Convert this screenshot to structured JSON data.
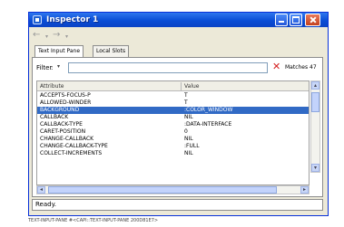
{
  "window": {
    "title": "Inspector 1"
  },
  "toolbar": {
    "back_icon": "left-arrow",
    "forward_icon": "right-arrow"
  },
  "tabs": [
    {
      "label": "Text Input Pane",
      "active": true
    },
    {
      "label": "Local Slots",
      "active": false
    }
  ],
  "filter": {
    "label": "Filter",
    "value": "",
    "matches": "Matches 47"
  },
  "table": {
    "columns": [
      "Attribute",
      "Value"
    ],
    "rows": [
      {
        "attribute": "ACCEPTS-FOCUS-P",
        "value": "T"
      },
      {
        "attribute": "ALLOWED-WINDER",
        "value": "T"
      },
      {
        "attribute": "BACKGROUND",
        "value": ":COLOR_WINDOW",
        "selected": true
      },
      {
        "attribute": "CALLBACK",
        "value": "NIL"
      },
      {
        "attribute": "CALLBACK-TYPE",
        "value": ":DATA-INTERFACE"
      },
      {
        "attribute": "CARET-POSITION",
        "value": "0"
      },
      {
        "attribute": "CHANGE-CALLBACK",
        "value": "NIL"
      },
      {
        "attribute": "CHANGE-CALLBACK-TYPE",
        "value": ":FULL"
      },
      {
        "attribute": "COLLECT-INCREMENTS",
        "value": "NIL"
      }
    ]
  },
  "status": "Ready.",
  "footer": "TEXT-INPUT-PANE #<CAPI::TEXT-INPUT-PANE 200D81E7>"
}
